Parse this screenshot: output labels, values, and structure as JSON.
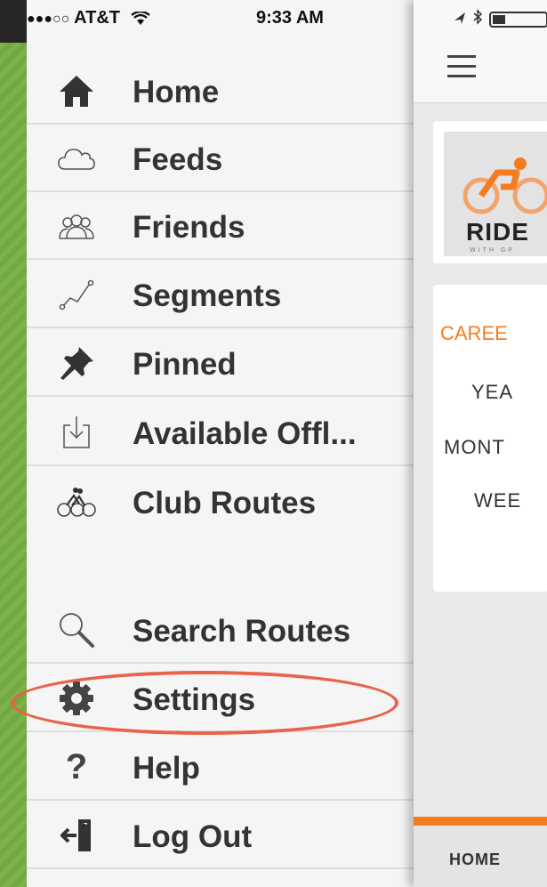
{
  "status_bar": {
    "carrier": "AT&T",
    "signal_dots": "●●●○○",
    "time": "9:33 AM"
  },
  "menu": {
    "items": [
      {
        "label": "Home",
        "icon": "home-icon"
      },
      {
        "label": "Feeds",
        "icon": "cloud-icon"
      },
      {
        "label": "Friends",
        "icon": "friends-icon"
      },
      {
        "label": "Segments",
        "icon": "segments-icon"
      },
      {
        "label": "Pinned",
        "icon": "pin-icon"
      },
      {
        "label": "Available Offl...",
        "icon": "download-icon"
      },
      {
        "label": "Club Routes",
        "icon": "cyclists-icon"
      },
      {
        "label": "Search Routes",
        "icon": "search-icon"
      },
      {
        "label": "Settings",
        "icon": "gear-icon"
      },
      {
        "label": "Help",
        "icon": "question-icon"
      },
      {
        "label": "Log Out",
        "icon": "logout-icon"
      }
    ]
  },
  "content": {
    "logo_text": "RIDE",
    "logo_sub": "WITH GP",
    "stats": {
      "career": "CAREE",
      "year": "YEA",
      "month": "MONT",
      "week": "WEE"
    },
    "bottom_tab": "HOME"
  },
  "colors": {
    "accent": "#f57c1f",
    "highlight": "#e8634a",
    "menu_bg": "#f5f5f5"
  }
}
